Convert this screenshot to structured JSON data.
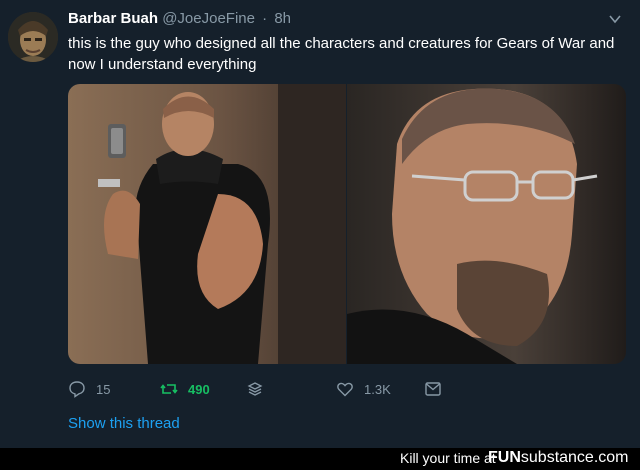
{
  "user": {
    "display_name": "Barbar Buah",
    "handle": "@JoeJoeFine",
    "separator": "·",
    "timestamp": "8h"
  },
  "tweet": {
    "text": "this is the guy who designed all the characters and creatures for Gears of War and now I understand everything"
  },
  "actions": {
    "replies": "15",
    "retweets": "490",
    "likes": "1.3K"
  },
  "show_thread_label": "Show this thread",
  "watermark": {
    "caption": "Kill your time at",
    "brand_fun": "FUN",
    "brand_substance": "substance",
    "brand_tld": ".com"
  },
  "colors": {
    "background": "#15202b",
    "secondary_text": "#8899a6",
    "link": "#1da1f2",
    "retweet_active": "#17bf63"
  },
  "icons": [
    "avatar",
    "caret-down-icon",
    "reply-icon",
    "retweet-icon",
    "stack-icon",
    "like-icon",
    "share-icon"
  ]
}
